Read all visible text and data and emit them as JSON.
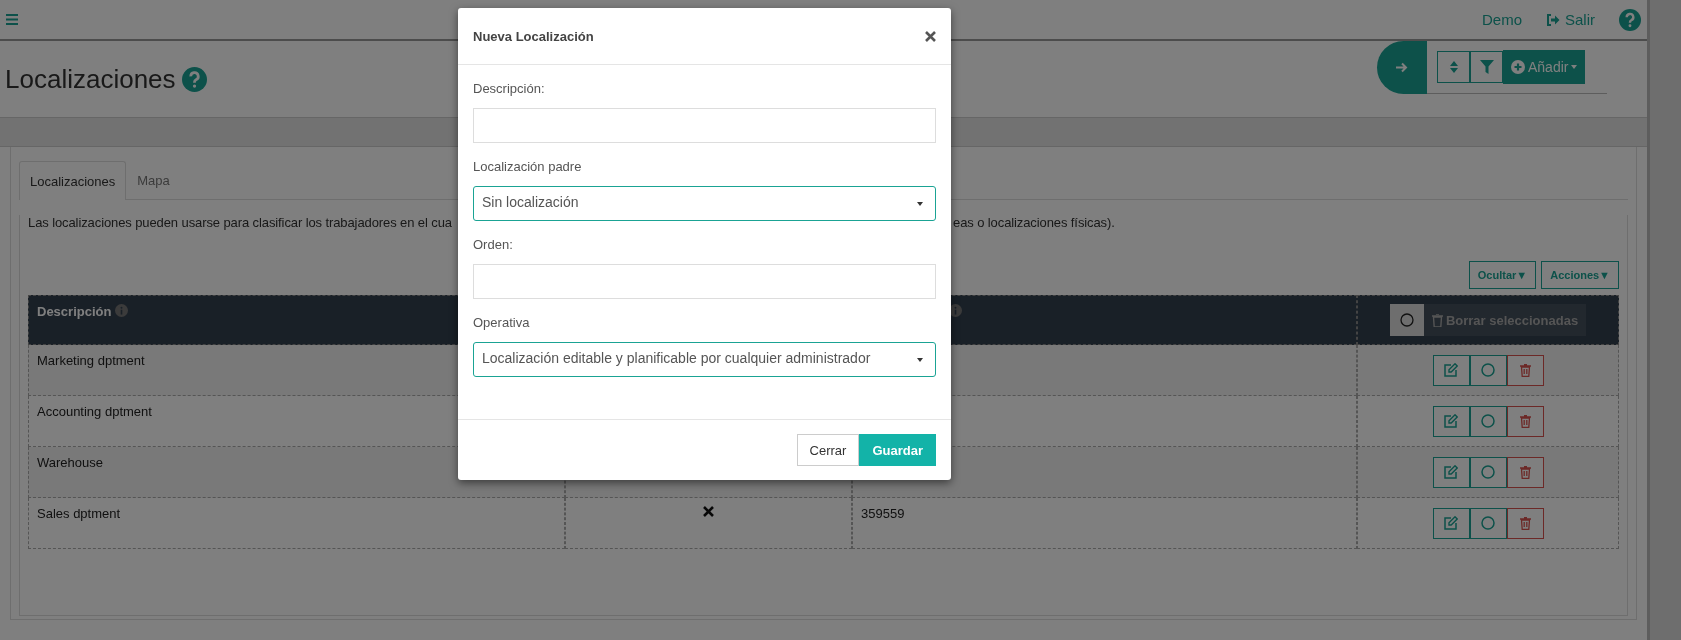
{
  "header": {
    "user": "Demo",
    "logout": "Salir"
  },
  "page": {
    "title": "Localizaciones"
  },
  "toolbar": {
    "add_button": "Añadir"
  },
  "tabs": [
    {
      "label": "Localizaciones",
      "selected": true
    },
    {
      "label": "Mapa",
      "selected": false
    }
  ],
  "description": [
    "Las localizaciones pueden usarse para clasificar los trabajadores en el cua",
    "eas o localizaciones físicas)."
  ],
  "table_buttons": [
    "Ocultar▼",
    "Acciones▼"
  ],
  "table": {
    "header": {
      "column_1": "Descripción",
      "all_selected": false,
      "delete_selected": {
        "label": "Borrar seleccionadas",
        "disabled": true
      }
    },
    "rows": [
      {
        "description": "Marketing dptment",
        "selected": false
      },
      {
        "description": "Accounting dptment",
        "selected": false
      },
      {
        "description": "Warehouse",
        "selected": false
      },
      {
        "description": "Sales dptment",
        "column_2_checked": false,
        "column_3": "359559",
        "selected": false
      }
    ]
  },
  "modal": {
    "title": "Nueva Localización",
    "fields": [
      {
        "kind": "input",
        "label": "Descripción:"
      },
      {
        "kind": "select",
        "label": "Localización padre",
        "value": "Sin localización"
      },
      {
        "kind": "input",
        "label": "Orden:"
      },
      {
        "kind": "select",
        "label": "Operativa",
        "value": "Localización editable y planificable por cualquier administrador"
      }
    ],
    "buttons": [
      {
        "label": "Cerrar",
        "primary": false
      },
      {
        "label": "Guardar",
        "primary": true
      }
    ]
  }
}
